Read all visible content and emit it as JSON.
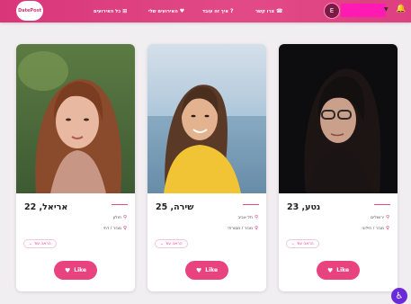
{
  "header": {
    "logo_text": "DatePost",
    "nav": [
      {
        "label": "כל האירועים",
        "icon": "⊞"
      },
      {
        "label": "האירועים שלי",
        "icon": "♥"
      },
      {
        "label": "איך זה עובד",
        "icon": "?"
      },
      {
        "label": "צרו קשר",
        "icon": "☎"
      }
    ],
    "avatar_letter": "E",
    "accent": "#d9367a"
  },
  "cards": [
    {
      "name": "נטע, 23",
      "city": "ירושלים",
      "details": "מגזר / חילוני",
      "more_label": "הראה עוד",
      "like_label": "Like"
    },
    {
      "name": "שירה, 25",
      "city": "תל אביב",
      "details": "מגזר / מסורתי",
      "more_label": "הראה עוד",
      "like_label": "Like"
    },
    {
      "name": "אריאל, 22",
      "city": "חולון",
      "details": "מגזר / דתי",
      "more_label": "הראה עוד",
      "like_label": "Like"
    }
  ],
  "accessibility_icon": "♿"
}
